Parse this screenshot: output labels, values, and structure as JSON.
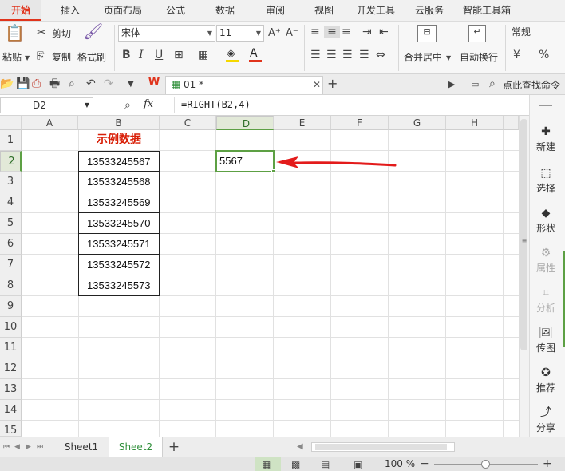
{
  "menubar": {
    "tabs": [
      "开始",
      "插入",
      "页面布局",
      "公式",
      "数据",
      "审阅",
      "视图",
      "开发工具",
      "云服务",
      "智能工具箱"
    ],
    "active": "开始"
  },
  "ribbon": {
    "paste": "粘贴",
    "cut": "剪切",
    "copy": "复制",
    "format_painter": "格式刷",
    "font_name": "宋体",
    "font_size": "11",
    "bold": "B",
    "italic": "I",
    "underline": "U",
    "merge_center": "合并居中",
    "wrap_text": "自动换行",
    "number_format": "常规",
    "percent": "%"
  },
  "quickbar": {
    "doc_tab": "01 *",
    "search": "点此查找命令"
  },
  "formula_bar": {
    "name_box": "D2",
    "fx": "fx",
    "formula": "=RIGHT(B2,4)"
  },
  "sheet": {
    "columns": [
      "A",
      "B",
      "C",
      "D",
      "E",
      "F",
      "G",
      "H"
    ],
    "rows": [
      "1",
      "2",
      "3",
      "4",
      "5",
      "6",
      "7",
      "8",
      "9",
      "10",
      "11",
      "12",
      "13",
      "14",
      "15"
    ],
    "selected_col": "D",
    "selected_row": "2",
    "header_cell": "示例数据",
    "b_values": [
      "13533245567",
      "13533245568",
      "13533245569",
      "13533245570",
      "13533245571",
      "13533245572",
      "13533245573"
    ],
    "d2_value": "5567"
  },
  "right_panel": {
    "items": [
      "新建",
      "选择",
      "形状",
      "属性",
      "分析",
      "传图",
      "推荐",
      "分享"
    ]
  },
  "sheet_tabs": {
    "tabs": [
      "Sheet1",
      "Sheet2"
    ],
    "active": "Sheet2",
    "add": "+"
  },
  "statusbar": {
    "zoom": "100 %"
  },
  "colors": {
    "accent": "#e0341c",
    "selection": "#5da044",
    "header_text": "#d81e06"
  }
}
